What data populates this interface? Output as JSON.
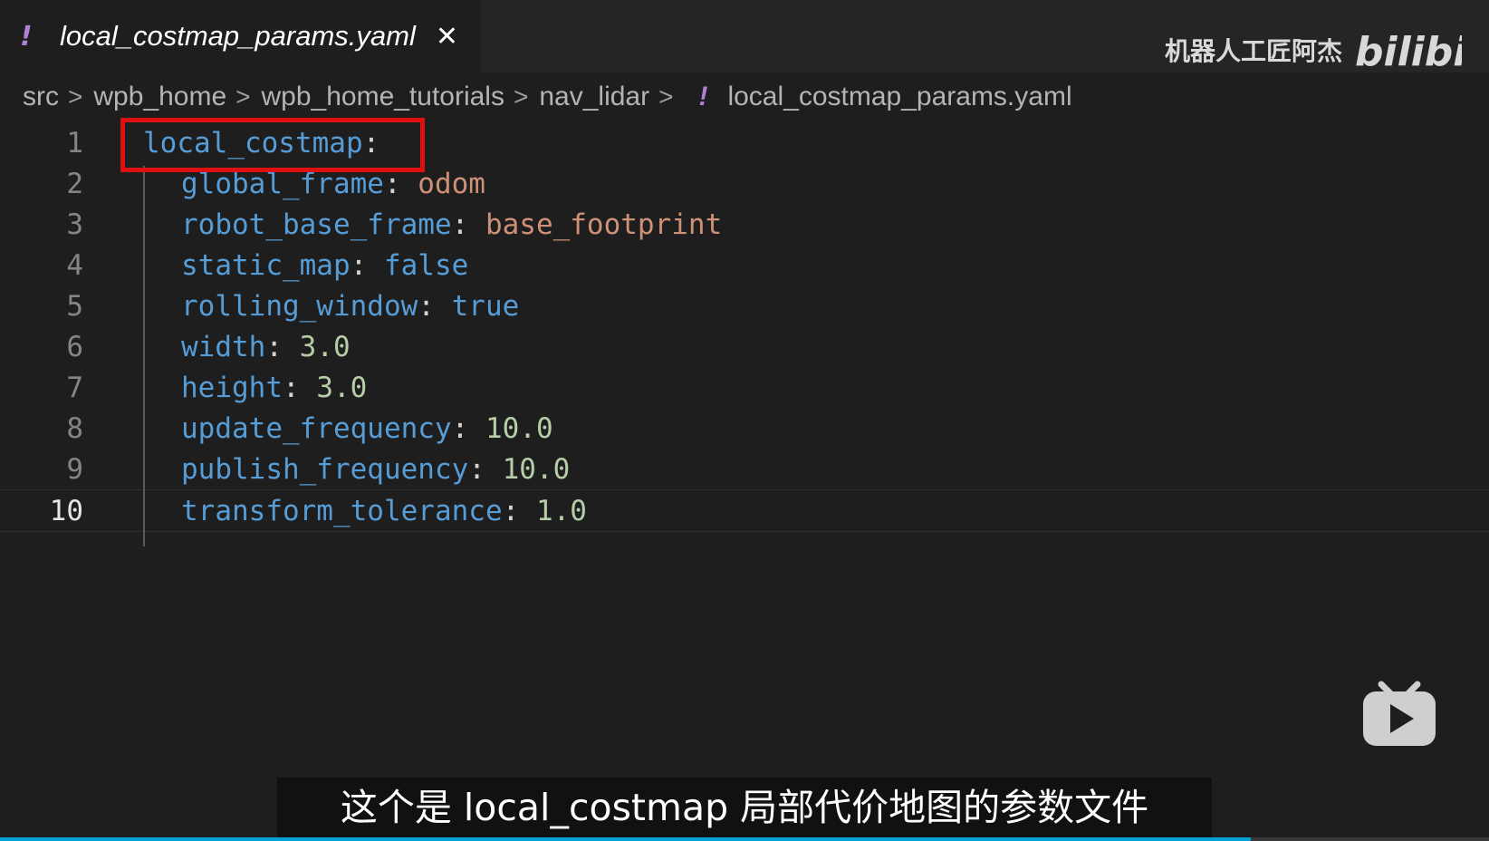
{
  "tab": {
    "icon": "!",
    "label": "local_costmap_params.yaml",
    "close": "✕"
  },
  "watermark": {
    "author": "机器人工匠阿杰",
    "logo_text": "bilibili"
  },
  "breadcrumb": {
    "items": [
      "src",
      "wpb_home",
      "wpb_home_tutorials",
      "nav_lidar"
    ],
    "separator": ">",
    "file_icon": "!",
    "file": "local_costmap_params.yaml"
  },
  "editor": {
    "current_line": 10,
    "lines": [
      {
        "n": "1",
        "key": "local_costmap",
        "sep": ":",
        "value": "",
        "type": ""
      },
      {
        "n": "2",
        "key": "global_frame",
        "sep": ": ",
        "value": "odom",
        "type": "str"
      },
      {
        "n": "3",
        "key": "robot_base_frame",
        "sep": ": ",
        "value": "base_footprint",
        "type": "str"
      },
      {
        "n": "4",
        "key": "static_map",
        "sep": ": ",
        "value": "false",
        "type": "bool"
      },
      {
        "n": "5",
        "key": "rolling_window",
        "sep": ": ",
        "value": "true",
        "type": "bool"
      },
      {
        "n": "6",
        "key": "width",
        "sep": ": ",
        "value": "3.0",
        "type": "num"
      },
      {
        "n": "7",
        "key": "height",
        "sep": ": ",
        "value": "3.0",
        "type": "num"
      },
      {
        "n": "8",
        "key": "update_frequency",
        "sep": ": ",
        "value": "10.0",
        "type": "num"
      },
      {
        "n": "9",
        "key": "publish_frequency",
        "sep": ": ",
        "value": "10.0",
        "type": "num"
      },
      {
        "n": "10",
        "key": "transform_tolerance",
        "sep": ": ",
        "value": "1.0",
        "type": "num"
      }
    ]
  },
  "subtitle": "这个是 local_costmap 局部代价地图的参数文件",
  "video": {
    "play_icon": "play-icon",
    "progress_fraction": 0.84
  },
  "colors": {
    "key": "#569cd6",
    "string": "#ce9178",
    "number": "#b5cea8",
    "highlight": "#e01010",
    "progress": "#00a1d6",
    "yaml_icon": "#b180d7"
  }
}
